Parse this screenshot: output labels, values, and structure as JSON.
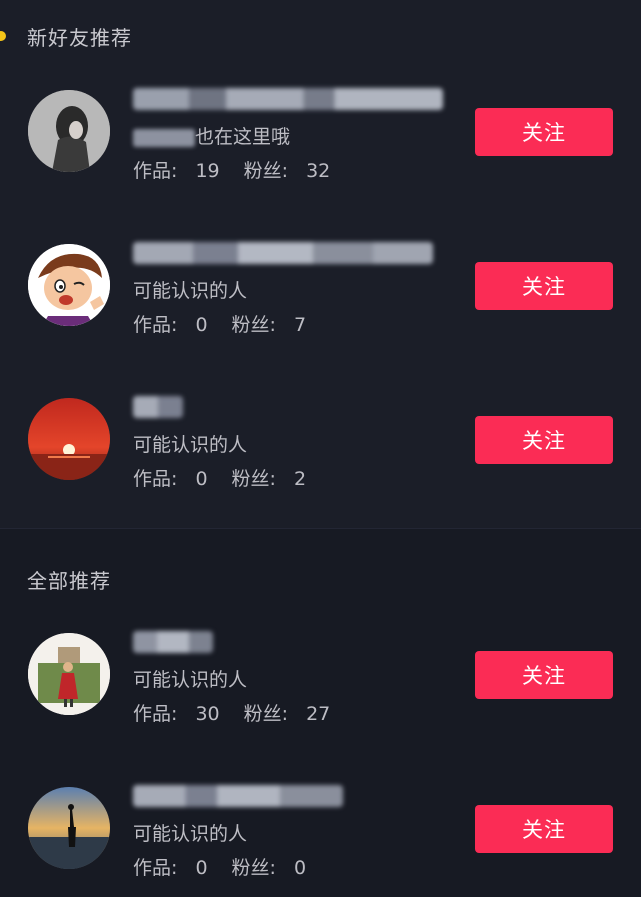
{
  "sections": {
    "new_friends_title": "新好友推荐",
    "all_title": "全部推荐"
  },
  "follow_label": "关注",
  "users": [
    {
      "subtitle_suffix": "也在这里哦",
      "works_label": "作品:",
      "works": "19",
      "fans_label": "粉丝:",
      "fans": "32",
      "avatar": "girl-bw-photo"
    },
    {
      "subtitle": "可能认识的人",
      "works_label": "作品:",
      "works": "0",
      "fans_label": "粉丝:",
      "fans": "7",
      "avatar": "cartoon-man"
    },
    {
      "subtitle": "可能认识的人",
      "works_label": "作品:",
      "works": "0",
      "fans_label": "粉丝:",
      "fans": "2",
      "avatar": "sunset-sea"
    },
    {
      "subtitle": "可能认识的人",
      "works_label": "作品:",
      "works": "30",
      "fans_label": "粉丝:",
      "fans": "27",
      "avatar": "woman-red-dress"
    },
    {
      "subtitle": "可能认识的人",
      "works_label": "作品:",
      "works": "0",
      "fans_label": "粉丝:",
      "fans": "0",
      "avatar": "beach-sunset-person"
    }
  ]
}
